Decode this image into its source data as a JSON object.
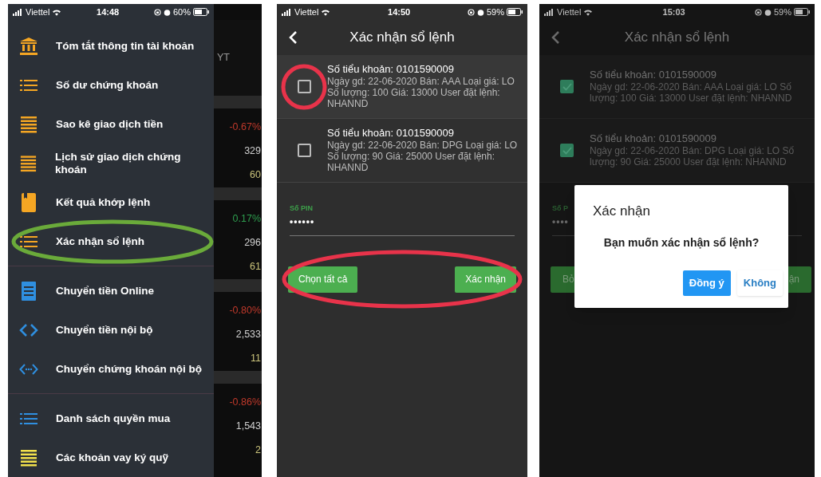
{
  "screens": [
    {
      "kind": "menu",
      "status_bar": {
        "carrier": "Viettel",
        "time": "14:48",
        "battery": "60%"
      },
      "menu_groups": [
        [
          {
            "label": "Tóm tắt thông tin tài khoản",
            "kind": "bank",
            "color": "#f5a623",
            "circled": false
          },
          {
            "label": "Số dư chứng khoán",
            "kind": "list",
            "color": "#f5a623",
            "circled": false
          },
          {
            "label": "Sao kê giao dịch tiền",
            "kind": "lines",
            "color": "#f5a623",
            "circled": false
          },
          {
            "label": "Lịch sử giao dịch chứng khoán",
            "kind": "lines",
            "color": "#f5a623",
            "circled": false
          },
          {
            "label": "Kết quả khớp lệnh",
            "kind": "book",
            "color": "#f5a623",
            "circled": false
          },
          {
            "label": "Xác nhận sổ lệnh",
            "kind": "list",
            "color": "#f5a623",
            "circled": true
          }
        ],
        [
          {
            "label": "Chuyển tiền Online",
            "kind": "receipt",
            "color": "#2f8fe0",
            "circled": false
          },
          {
            "label": "Chuyển tiền nội bộ",
            "kind": "code",
            "color": "#2f8fe0",
            "circled": false
          },
          {
            "label": "Chuyển chứng khoán nội bộ",
            "kind": "code-dots",
            "color": "#2f8fe0",
            "circled": false
          }
        ],
        [
          {
            "label": "Danh sách quyền mua",
            "kind": "list",
            "color": "#2f8fe0",
            "circled": false
          },
          {
            "label": "Các khoản vay ký quỹ",
            "kind": "lines",
            "color": "#f2e14c",
            "circled": false
          }
        ]
      ],
      "background_header": "YT",
      "background_groups": [
        [
          {
            "text": "-0.67%",
            "color": "#c0392b"
          },
          {
            "text": "329",
            "color": "#cfcfcf"
          },
          {
            "text": "60",
            "color": "#c9c27a"
          }
        ],
        [
          {
            "text": "0.17%",
            "color": "#2e9e4f"
          },
          {
            "text": "296",
            "color": "#cfcfcf"
          },
          {
            "text": "61",
            "color": "#c9c27a"
          }
        ],
        [
          {
            "text": "-0.80%",
            "color": "#c0392b"
          },
          {
            "text": "2,533",
            "color": "#cfcfcf"
          },
          {
            "text": "11",
            "color": "#c9c27a"
          }
        ],
        [
          {
            "text": "-0.86%",
            "color": "#c0392b"
          },
          {
            "text": "1,543",
            "color": "#cfcfcf"
          },
          {
            "text": "2",
            "color": "#c9c27a"
          }
        ]
      ]
    },
    {
      "kind": "confirm",
      "dimmed": false,
      "status_bar": {
        "carrier": "Viettel",
        "time": "14:50",
        "battery": "59%"
      },
      "title": "Xác nhận sổ lệnh",
      "orders": [
        {
          "account": "Số tiểu khoản: 0101590009",
          "details": "Ngày gd: 22-06-2020 Bán: AAA Loại giá: LO Số lượng: 100 Giá: 13000 User đặt lệnh: NHANND",
          "checked": false,
          "circled": true
        },
        {
          "account": "Số tiểu khoản: 0101590009",
          "details": "Ngày gd: 22-06-2020 Bán: DPG Loại giá: LO Số lượng: 90 Giá: 25000 User đặt lệnh: NHANND",
          "checked": false,
          "circled": false
        }
      ],
      "pin": {
        "label": "Số PIN",
        "value": "••••••"
      },
      "buttons": [
        "Chọn tất cả",
        "Xác nhận"
      ],
      "buttons_circled": true
    },
    {
      "kind": "confirm",
      "dimmed": true,
      "status_bar": {
        "carrier": "Viettel",
        "time": "15:03",
        "battery": "59%"
      },
      "title": "Xác nhận sổ lệnh",
      "orders": [
        {
          "account": "Số tiểu khoản: 0101590009",
          "details": "Ngày gd: 22-06-2020 Bán: AAA Loại giá: LO Số lượng: 100 Giá: 13000 User đặt lệnh: NHANND",
          "checked": true,
          "circled": false
        },
        {
          "account": "Số tiểu khoản: 0101590009",
          "details": "Ngày gd: 22-06-2020 Bán: DPG Loại giá: LO Số lượng: 90 Giá: 25000 User đặt lệnh: NHANND",
          "checked": true,
          "circled": false
        }
      ],
      "pin": {
        "label": "Số P",
        "value": "••••"
      },
      "buttons": [
        "Bỏ",
        "ận"
      ],
      "buttons_circled": false,
      "dialog": {
        "title": "Xác nhận",
        "message": "Bạn muốn xác nhận sổ lệnh?",
        "buttons": [
          {
            "label": "Đồng ý",
            "primary": true
          },
          {
            "label": "Không",
            "primary": false
          }
        ]
      }
    }
  ]
}
